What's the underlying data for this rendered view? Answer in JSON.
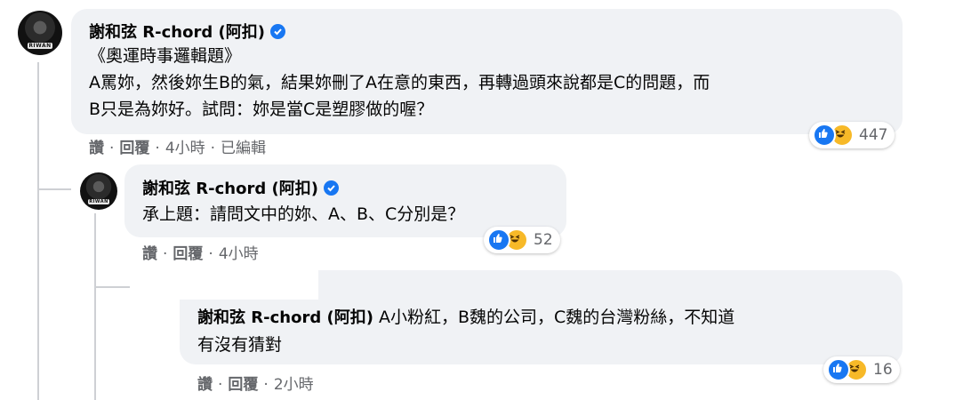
{
  "comments": [
    {
      "author": "謝和弦 R-chord (阿扣)",
      "lines": [
        "《奧運時事邏輯題》",
        "A罵妳，然後妳生B的氣，結果妳刪了A在意的東西，再轉過頭來說都是C的問題，而",
        "B只是為妳好。試問：妳是當C是塑膠做的喔？"
      ],
      "actions": {
        "like": "讚",
        "reply": "回覆",
        "time": "4小時",
        "edited": "已編輯"
      },
      "reaction_count": "447"
    },
    {
      "author": "謝和弦 R-chord (阿扣)",
      "lines": [
        "承上題：請問文中的妳、A、B、C分別是？"
      ],
      "actions": {
        "like": "讚",
        "reply": "回覆",
        "time": "4小時"
      },
      "reaction_count": "52"
    },
    {
      "author": "謝和弦 R-chord (阿扣)",
      "inline_text": " A小粉紅，B魏的公司，C魏的台灣粉絲，不知道",
      "line2": "有沒有猜對",
      "actions": {
        "like": "讚",
        "reply": "回覆",
        "time": "2小時"
      },
      "reaction_count": "16"
    }
  ],
  "avatar_badge": "RIWAN",
  "colors": {
    "bubble": "#f0f2f5",
    "meta": "#65676b",
    "verified": "#1877f2",
    "like": "#1877f2",
    "haha": "#f7b928"
  }
}
